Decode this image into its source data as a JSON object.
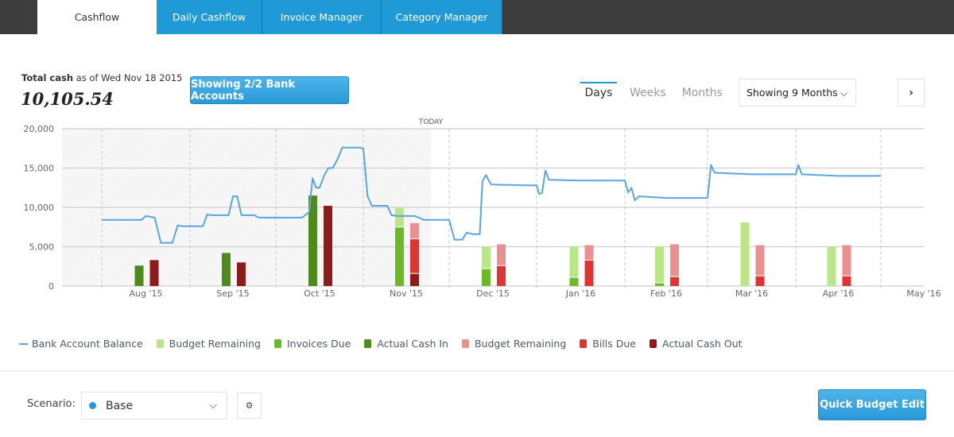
{
  "tabs": [
    {
      "label": "Cashflow",
      "active": true
    },
    {
      "label": "Daily Cashflow",
      "active": false
    },
    {
      "label": "Invoice Manager",
      "active": false
    },
    {
      "label": "Category Manager",
      "active": false
    }
  ],
  "summary": {
    "total_bold": "Total cash",
    "total_suffix": " as of Wed Nov 18 2015",
    "total_value": "10,105.54",
    "bank_button": "Showing 2/2 Bank Accounts"
  },
  "range": {
    "options": [
      "Days",
      "Weeks",
      "Months"
    ],
    "active": "Days",
    "showing": "Showing 9 Months",
    "next_icon": "chevron-right-icon"
  },
  "colors": {
    "balance": "#5aa5dc",
    "budget_in": "#b9e686",
    "invoices_due": "#6cb827",
    "actual_in": "#4f8a1d",
    "budget_out": "#e99090",
    "bills_due": "#df3434",
    "actual_out": "#8e1a1a",
    "accent": "#1f9ad6"
  },
  "chart_data": {
    "type": "bar",
    "title": "",
    "xlabel": "",
    "ylabel": "",
    "ylim": [
      0,
      20000
    ],
    "yticks": [
      "0",
      "5,000",
      "10,000",
      "15,000",
      "20,000"
    ],
    "today_label": "TODAY",
    "today_date": "2015-11-18",
    "grid": true,
    "legend_position": "bottom",
    "categories": [
      "Aug '15",
      "Sep '15",
      "Oct '15",
      "Nov '15",
      "Dec '15",
      "Jan '16",
      "Feb '16",
      "Mar '16",
      "Apr '16"
    ],
    "extra_tick": "May '16",
    "series": [
      {
        "name": "Actual Cash In",
        "stack": "in",
        "color_key": "actual_in",
        "values": [
          2600,
          4200,
          11500,
          0,
          0,
          0,
          0,
          0,
          0
        ]
      },
      {
        "name": "Invoices Due",
        "stack": "in",
        "color_key": "invoices_due",
        "values": [
          0,
          0,
          0,
          7500,
          2200,
          1100,
          400,
          0,
          0
        ]
      },
      {
        "name": "Budget Remaining",
        "stack": "in",
        "color_key": "budget_in",
        "values": [
          0,
          0,
          0,
          2500,
          2800,
          3900,
          4600,
          8100,
          5000
        ]
      },
      {
        "name": "Actual Cash Out",
        "stack": "out",
        "color_key": "actual_out",
        "values": [
          3300,
          3000,
          10200,
          1600,
          0,
          0,
          0,
          0,
          0
        ]
      },
      {
        "name": "Bills Due",
        "stack": "out",
        "color_key": "bills_due",
        "values": [
          0,
          0,
          0,
          4400,
          2600,
          3300,
          1200,
          1300,
          1300
        ]
      },
      {
        "name": "Budget Remaining",
        "stack": "out",
        "color_key": "budget_out",
        "values": [
          0,
          0,
          0,
          2000,
          2700,
          1900,
          4100,
          3900,
          3900
        ]
      }
    ],
    "balance_line": {
      "name": "Bank Account Balance",
      "x_start": "Aug '15",
      "points_month_frac": [
        [
          0.0,
          8400
        ],
        [
          0.45,
          8400
        ],
        [
          0.5,
          8900
        ],
        [
          0.55,
          8800
        ],
        [
          0.6,
          8700
        ],
        [
          0.67,
          5500
        ],
        [
          0.8,
          5500
        ],
        [
          0.86,
          7700
        ],
        [
          0.92,
          7600
        ],
        [
          1.15,
          7600
        ],
        [
          1.2,
          9100
        ],
        [
          1.25,
          9000
        ],
        [
          1.45,
          9000
        ],
        [
          1.5,
          11400
        ],
        [
          1.55,
          11400
        ],
        [
          1.6,
          9000
        ],
        [
          1.75,
          9000
        ],
        [
          1.8,
          8700
        ],
        [
          2.1,
          8700
        ],
        [
          2.15,
          8700
        ],
        [
          2.3,
          8700
        ],
        [
          2.38,
          9400
        ],
        [
          2.42,
          13700
        ],
        [
          2.46,
          12500
        ],
        [
          2.5,
          12500
        ],
        [
          2.55,
          14000
        ],
        [
          2.6,
          15000
        ],
        [
          2.65,
          15000
        ],
        [
          2.7,
          16000
        ],
        [
          2.76,
          17600
        ],
        [
          2.95,
          17600
        ],
        [
          3.0,
          17500
        ],
        [
          3.05,
          11400
        ],
        [
          3.1,
          10200
        ],
        [
          3.28,
          10200
        ],
        [
          3.33,
          9000
        ],
        [
          3.4,
          8900
        ],
        [
          3.6,
          8900
        ],
        [
          3.65,
          8700
        ],
        [
          3.7,
          8400
        ],
        [
          3.85,
          8400
        ],
        [
          4.0,
          8400
        ],
        [
          4.06,
          5900
        ],
        [
          4.15,
          5900
        ],
        [
          4.2,
          6800
        ],
        [
          4.27,
          6600
        ],
        [
          4.35,
          6600
        ],
        [
          4.38,
          13300
        ],
        [
          4.42,
          14100
        ],
        [
          4.48,
          12900
        ],
        [
          4.9,
          12800
        ],
        [
          5.0,
          12800
        ],
        [
          5.03,
          11700
        ],
        [
          5.06,
          11800
        ],
        [
          5.1,
          14700
        ],
        [
          5.14,
          13500
        ],
        [
          5.5,
          13400
        ],
        [
          6.0,
          13400
        ],
        [
          6.04,
          11900
        ],
        [
          6.08,
          12500
        ],
        [
          6.12,
          10900
        ],
        [
          6.17,
          11400
        ],
        [
          6.5,
          11200
        ],
        [
          7.0,
          11200
        ],
        [
          7.04,
          15400
        ],
        [
          7.08,
          14400
        ],
        [
          7.5,
          14200
        ],
        [
          8.0,
          14200
        ],
        [
          8.03,
          15400
        ],
        [
          8.07,
          14200
        ],
        [
          8.5,
          14000
        ],
        [
          9.0,
          14000
        ]
      ]
    },
    "legend": [
      {
        "label": "Bank Account Balance",
        "kind": "line",
        "color_key": "balance"
      },
      {
        "label": "Budget Remaining",
        "kind": "box",
        "color_key": "budget_in"
      },
      {
        "label": "Invoices Due",
        "kind": "box",
        "color_key": "invoices_due"
      },
      {
        "label": "Actual Cash In",
        "kind": "box",
        "color_key": "actual_in"
      },
      {
        "label": "Budget Remaining",
        "kind": "box",
        "color_key": "budget_out"
      },
      {
        "label": "Bills Due",
        "kind": "box",
        "color_key": "bills_due"
      },
      {
        "label": "Actual Cash Out",
        "kind": "box",
        "color_key": "actual_out"
      }
    ]
  },
  "footer": {
    "scenario_label": "Scenario:",
    "scenario_value": "Base",
    "settings_icon": "gear-icon",
    "quick_budget": "Quick Budget Edit"
  }
}
